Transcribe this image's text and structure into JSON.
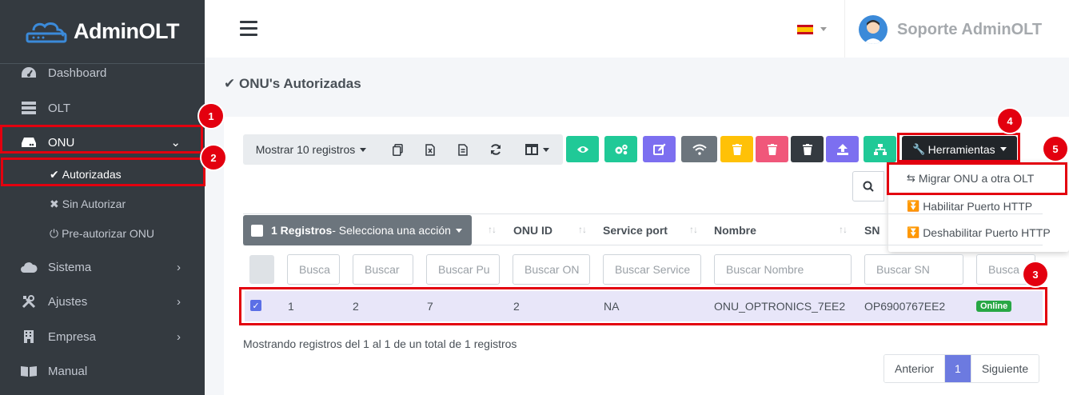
{
  "brand": {
    "name": "AdminOLT"
  },
  "sidebar": {
    "items": [
      {
        "label": "Dashboard",
        "icon": "dashboard-icon"
      },
      {
        "label": "OLT",
        "icon": "server-icon"
      },
      {
        "label": "ONU",
        "icon": "hdd-icon",
        "expanded": true
      },
      {
        "label": "Sistema",
        "icon": "cloud-icon"
      },
      {
        "label": "Ajustes",
        "icon": "tools-icon"
      },
      {
        "label": "Empresa",
        "icon": "building-icon"
      },
      {
        "label": "Manual",
        "icon": "book-icon"
      }
    ],
    "sub_items": [
      {
        "label": "Autorizadas",
        "icon": "check-icon"
      },
      {
        "label": "Sin Autorizar",
        "icon": "times-icon"
      },
      {
        "label": "Pre-autorizar ONU",
        "icon": "plug-icon"
      }
    ]
  },
  "header": {
    "user_name": "Soporte AdminOLT",
    "language": "es"
  },
  "page": {
    "title": "ONU's Autorizadas"
  },
  "toolbar": {
    "show_label": "Mostrar 10 registros",
    "tools_label": "Herramientas",
    "tools_menu": [
      "Migrar ONU a otra OLT",
      "Habilitar Puerto HTTP",
      "Deshabilitar Puerto HTTP"
    ]
  },
  "table": {
    "bulk_count": "1 Registros",
    "bulk_action": " - Selecciona una acción",
    "columns": [
      "ONU ID",
      "Service port",
      "Nombre",
      "SN"
    ],
    "filters": [
      "Busca",
      "Buscar",
      "Buscar Pu",
      "Buscar ON",
      "Buscar Service",
      "Buscar Nombre",
      "Buscar SN",
      "Busca"
    ],
    "row": {
      "c1": "1",
      "c2": "2",
      "c3": "7",
      "onu_id": "2",
      "service_port": "NA",
      "nombre": "ONU_OPTRONICS_7EE2",
      "sn": "OP6900767EE2",
      "status": "Online"
    },
    "info": "Mostrando registros del 1 al 1 de un total de 1 registros"
  },
  "pagination": {
    "prev": "Anterior",
    "current": "1",
    "next": "Siguiente"
  },
  "annotations": [
    "1",
    "2",
    "3",
    "4",
    "5"
  ],
  "colors": {
    "annotation": "#e3000f",
    "sidebar": "#343a40",
    "success": "#28a745",
    "primary": "#6c7ae0"
  }
}
